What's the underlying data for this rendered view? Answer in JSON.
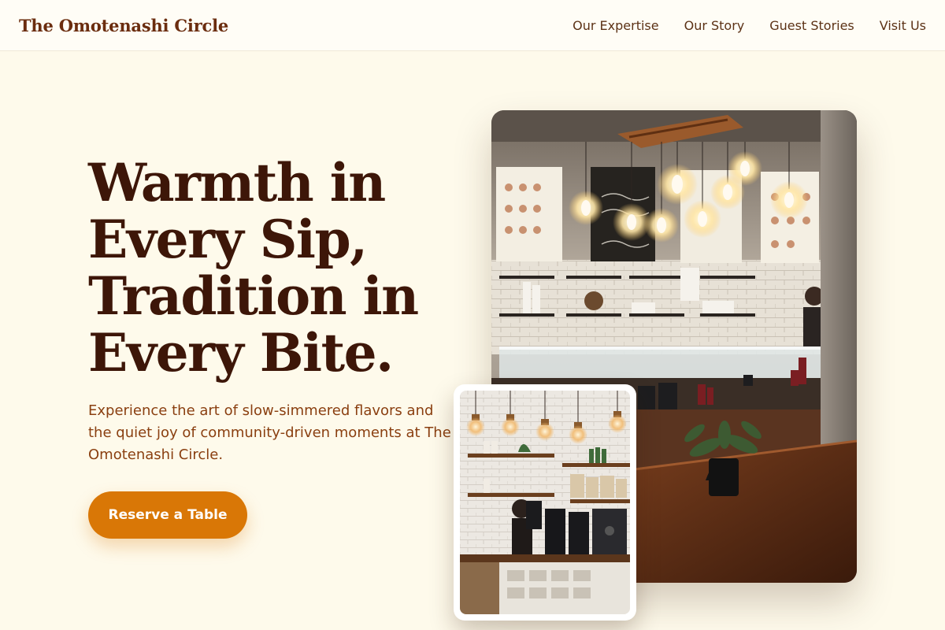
{
  "nav": {
    "brand": "The Omotenashi Circle",
    "links": [
      "Our Expertise",
      "Our Story",
      "Guest Stories",
      "Visit Us"
    ]
  },
  "hero": {
    "title_lines": [
      "Warmth in",
      "Every Sip,",
      "Tradition in",
      "Every Bite."
    ],
    "subtitle": "Experience the art of slow-simmered flavors and the quiet joy of community-driven moments at The Omotenashi Circle.",
    "cta_label": "Reserve a Table"
  },
  "images": {
    "main_alt": "Cafe interior with pendant bulbs, menu boards and wooden counter",
    "secondary_alt": "Coffee bar with hanging lights, shelves and espresso grinders"
  },
  "colors": {
    "page_background": "#fefaeb",
    "brand": "#6b2d0f",
    "heading": "#3d1608",
    "subtitle": "#8a3f10",
    "accent": "#d97706"
  }
}
